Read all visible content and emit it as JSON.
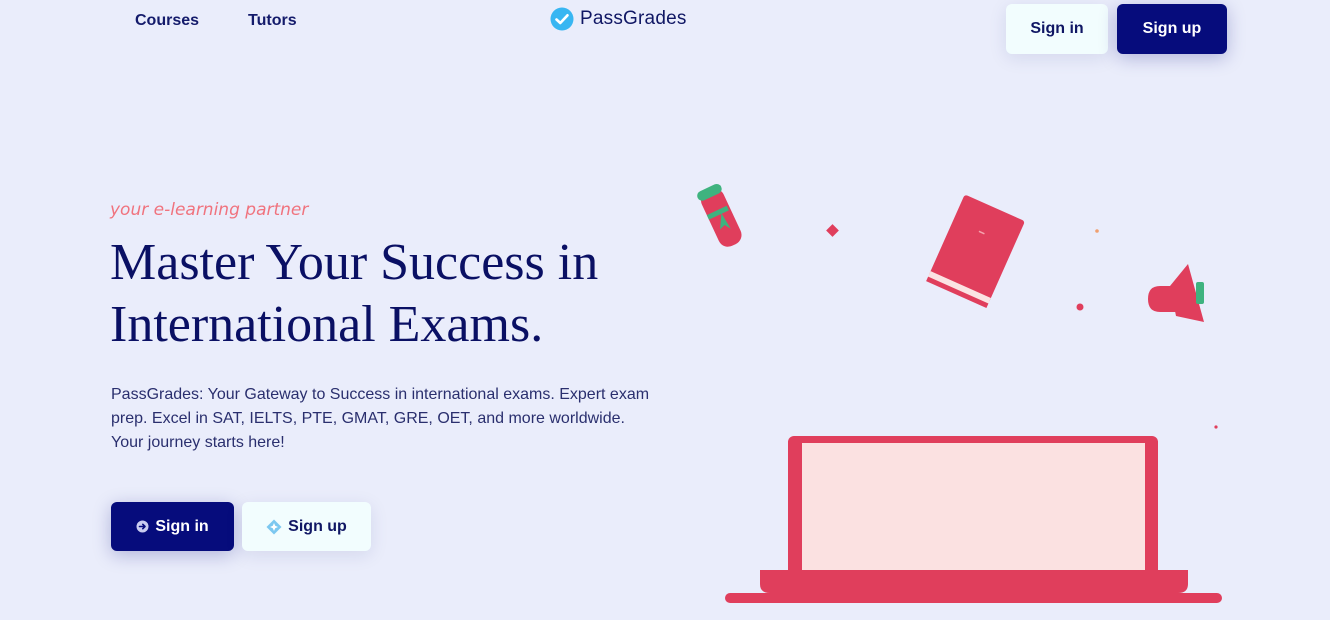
{
  "header": {
    "nav": [
      {
        "label": "Courses"
      },
      {
        "label": "Tutors"
      }
    ],
    "brand": {
      "name": "PassGrades",
      "icon": "check-badge-icon"
    },
    "sign_in_label": "Sign in",
    "sign_up_label": "Sign up"
  },
  "hero": {
    "tagline": "your e-learning partner",
    "title_line1": "Master Your Success in",
    "title_line2": "International Exams.",
    "description": "PassGrades: Your Gateway to Success in international exams. Expert exam prep. Excel in SAT, IELTS, PTE, GMAT, GRE, OET, and more worldwide. Your journey starts here!",
    "sign_in_label": "Sign in",
    "sign_up_label": "Sign up",
    "sign_in_icon": "arrow-circle-icon",
    "sign_up_icon": "diamond-sparkle-icon"
  },
  "colors": {
    "background": "#eaedfb",
    "primary_dark": "#060c7c",
    "accent_red": "#e03e5c",
    "accent_coral": "#f0737e",
    "light_button": "#f2fdfe"
  }
}
